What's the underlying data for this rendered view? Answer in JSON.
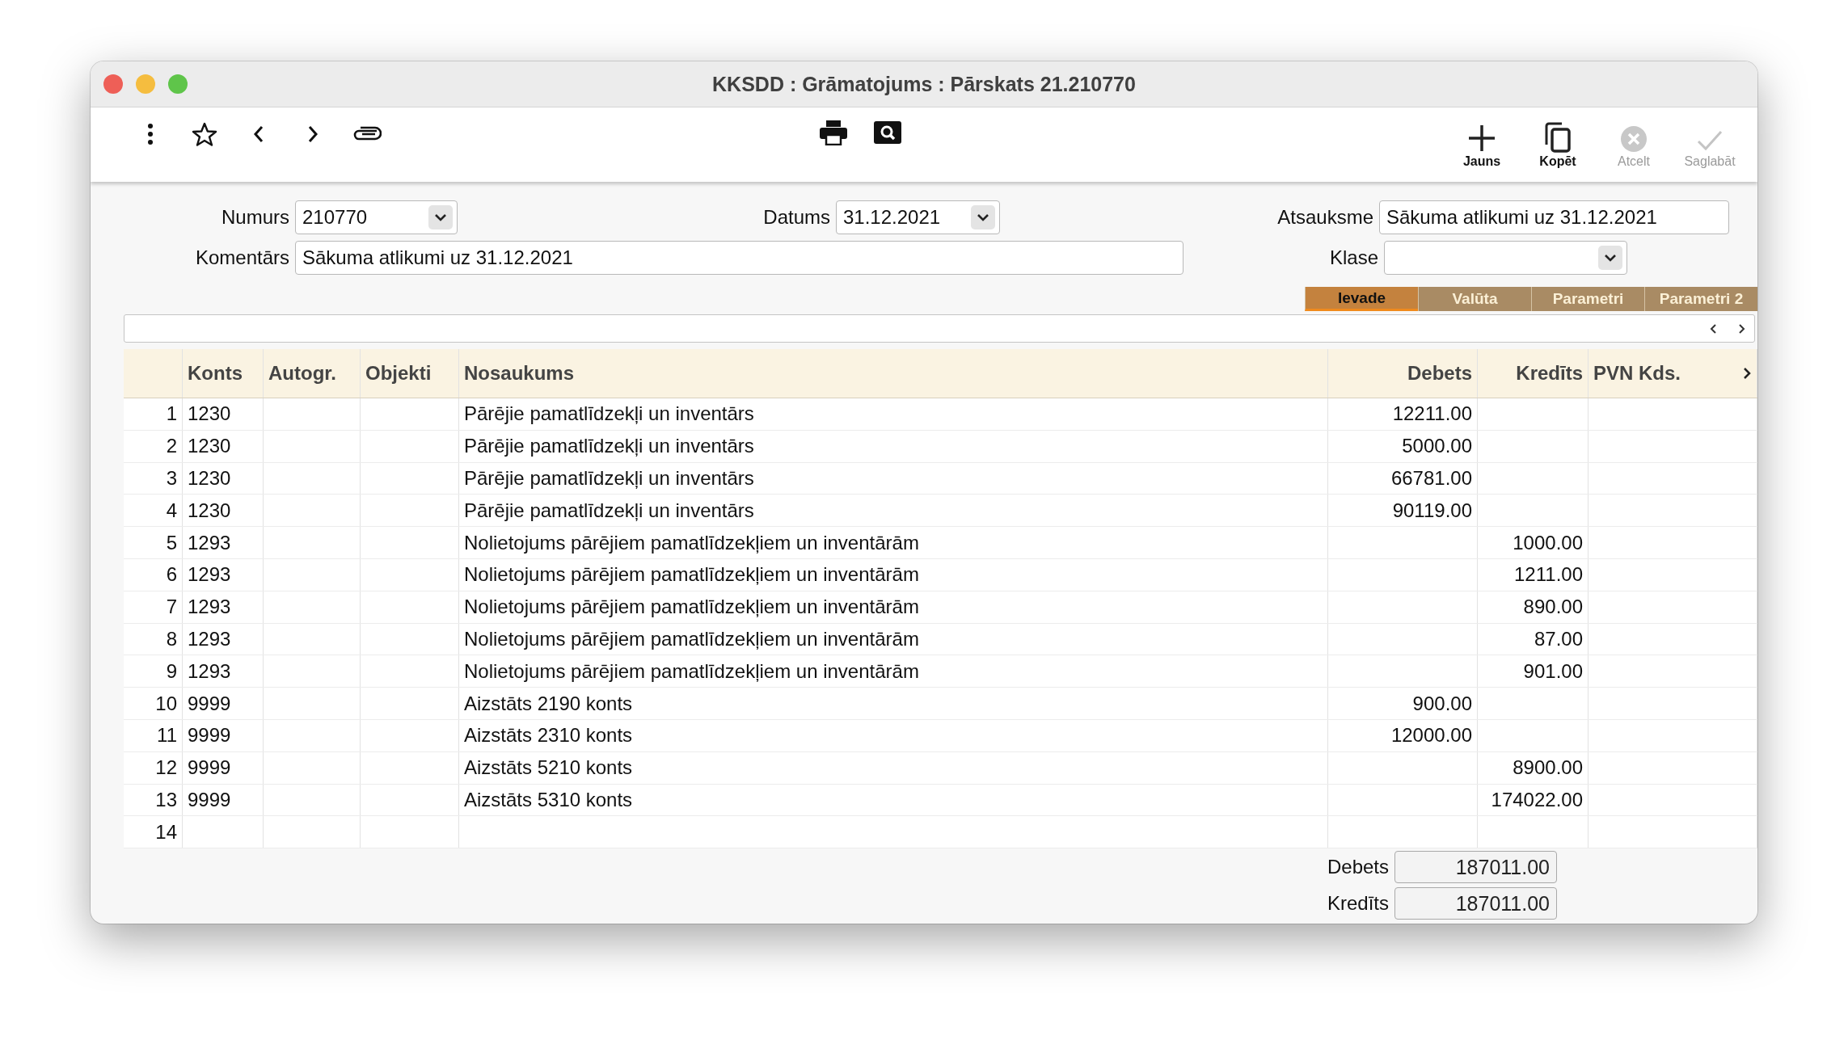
{
  "window": {
    "title": "KKSDD : Grāmatojums : Pārskats 21.210770"
  },
  "toolbar": {
    "left": [
      {
        "kind": "more"
      },
      {
        "kind": "star"
      },
      {
        "kind": "back"
      },
      {
        "kind": "forward"
      },
      {
        "kind": "attach"
      }
    ],
    "center": [
      {
        "kind": "print"
      },
      {
        "kind": "preview"
      }
    ],
    "actions": [
      {
        "kind": "new",
        "label": "Jauns",
        "disabled": false
      },
      {
        "kind": "copy",
        "label": "Kopēt",
        "disabled": false
      },
      {
        "kind": "cancel",
        "label": "Atcelt",
        "disabled": true
      },
      {
        "kind": "save",
        "label": "Saglabāt",
        "disabled": true
      }
    ]
  },
  "form": {
    "numurs": {
      "label": "Numurs",
      "value": "210770"
    },
    "datums": {
      "label": "Datums",
      "value": "31.12.2021"
    },
    "atsauksme": {
      "label": "Atsauksme",
      "value": "Sākuma atlikumi uz 31.12.2021"
    },
    "komentars": {
      "label": "Komentārs",
      "value": "Sākuma atlikumi uz 31.12.2021"
    },
    "klase": {
      "label": "Klase"
    }
  },
  "tabs": [
    {
      "label": "Ievade",
      "selected": true
    },
    {
      "label": "Valūta",
      "selected": false
    },
    {
      "label": "Parametri",
      "selected": false
    },
    {
      "label": "Parametri 2",
      "selected": false
    }
  ],
  "table": {
    "columns": [
      "Konts",
      "Autogr.",
      "Objekti",
      "Nosaukums",
      "Debets",
      "Kredīts",
      "PVN Kds."
    ],
    "rows": [
      {
        "number": "1",
        "konts": "1230",
        "nosaukums": "Pārējie pamatlīdzekļi un inventārs",
        "debets": "12211.00"
      },
      {
        "number": "2",
        "konts": "1230",
        "nosaukums": "Pārējie pamatlīdzekļi un inventārs",
        "debets": "5000.00"
      },
      {
        "number": "3",
        "konts": "1230",
        "nosaukums": "Pārējie pamatlīdzekļi un inventārs",
        "debets": "66781.00"
      },
      {
        "number": "4",
        "konts": "1230",
        "nosaukums": "Pārējie pamatlīdzekļi un inventārs",
        "debets": "90119.00"
      },
      {
        "number": "5",
        "konts": "1293",
        "nosaukums": "Nolietojums pārējiem pamatlīdzekļiem un inventārām",
        "kredits": "1000.00"
      },
      {
        "number": "6",
        "konts": "1293",
        "nosaukums": "Nolietojums pārējiem pamatlīdzekļiem un inventārām",
        "kredits": "1211.00"
      },
      {
        "number": "7",
        "konts": "1293",
        "nosaukums": "Nolietojums pārējiem pamatlīdzekļiem un inventārām",
        "kredits": "890.00"
      },
      {
        "number": "8",
        "konts": "1293",
        "nosaukums": "Nolietojums pārējiem pamatlīdzekļiem un inventārām",
        "kredits": "87.00"
      },
      {
        "number": "9",
        "konts": "1293",
        "nosaukums": "Nolietojums pārējiem pamatlīdzekļiem un inventārām",
        "kredits": "901.00"
      },
      {
        "number": "10",
        "konts": "9999",
        "nosaukums": "Aizstāts 2190 konts",
        "debets": "900.00"
      },
      {
        "number": "11",
        "konts": "9999",
        "nosaukums": "Aizstāts 2310 konts",
        "debets": "12000.00"
      },
      {
        "number": "12",
        "konts": "9999",
        "nosaukums": "Aizstāts 5210 konts",
        "kredits": "8900.00"
      },
      {
        "number": "13",
        "konts": "9999",
        "nosaukums": "Aizstāts 5310 konts",
        "kredits": "174022.00"
      },
      {
        "number": "14"
      }
    ]
  },
  "totals": [
    {
      "label": "Debets",
      "value": "187011.00"
    },
    {
      "label": "Kredīts",
      "value": "187011.00"
    }
  ]
}
